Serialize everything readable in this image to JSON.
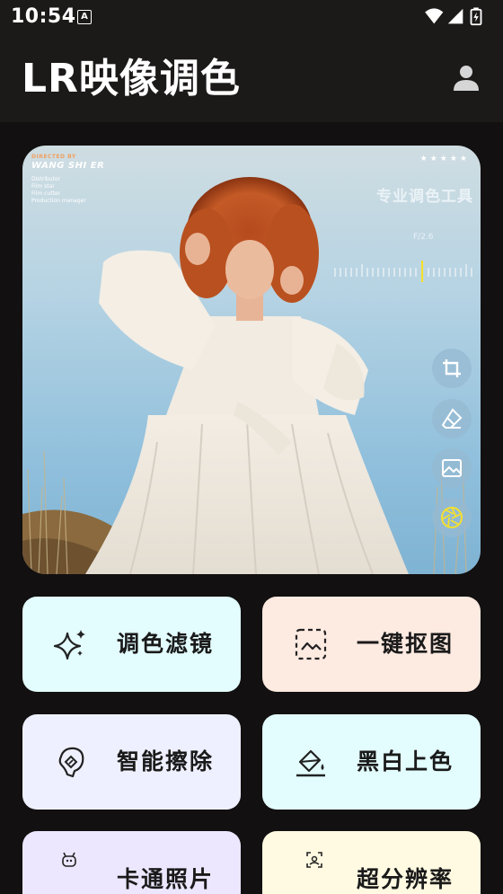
{
  "status_bar": {
    "time": "10:54",
    "notification_icon_letter": "A",
    "icons": [
      "wifi-icon",
      "cellular-signal-icon",
      "battery-charging-icon"
    ]
  },
  "app_bar": {
    "title": "LR映像调色",
    "profile_icon": "person-icon"
  },
  "hero": {
    "credit_top": "DIRECTED BY",
    "credit_name": "WANG SHI ER",
    "credit_lines": [
      "Distributor",
      "Film star",
      "Film cutter",
      "Production manager"
    ],
    "stars": "★★★★★",
    "tagline": "专业调色工具",
    "aperture_text": "F/2.6",
    "tools": [
      "crop-icon",
      "eraser-icon",
      "image-icon",
      "aperture-icon"
    ]
  },
  "features": [
    {
      "label": "调色滤镜",
      "icon": "sparkle-icon",
      "bg": "#e3fcfd"
    },
    {
      "label": "一键抠图",
      "icon": "cutout-frame-icon",
      "bg": "#fdeae1"
    },
    {
      "label": "智能擦除",
      "icon": "magic-erase-icon",
      "bg": "#eef0ff"
    },
    {
      "label": "黑白上色",
      "icon": "paint-bucket-icon",
      "bg": "#e3fcfd"
    },
    {
      "label": "卡通照片",
      "icon": "cartoon-face-icon",
      "bg": "#ece7ff"
    },
    {
      "label": "超分辨率",
      "icon": "scan-enhance-icon",
      "bg": "#fffae1"
    }
  ],
  "colors": {
    "background": "#121010",
    "app_bar": "#1c1919",
    "tool_button": "#96b9d2",
    "aperture_accent": "#f4e02e"
  }
}
